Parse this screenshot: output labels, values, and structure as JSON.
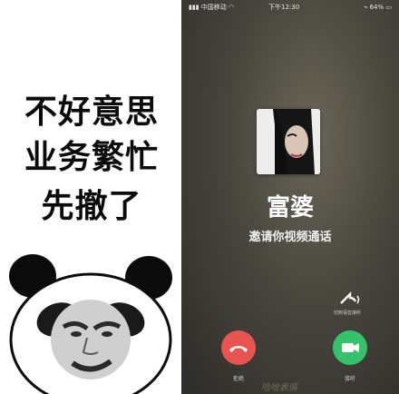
{
  "meme": {
    "caption_lines": [
      "不好意思",
      "业务繁忙",
      "先撤了"
    ]
  },
  "call": {
    "status_bar": {
      "carrier": "中国移动",
      "time": "下午12:30",
      "battery": "64%"
    },
    "caller_name": "富婆",
    "subtitle": "邀请你视频通话",
    "switch_label": "切到语音接听",
    "decline_label": "拒绝",
    "accept_label": "接听",
    "watermark": "哈哈表情"
  },
  "colors": {
    "decline": "#e85550",
    "accept": "#36c26a",
    "caption_text": "#0b0b0b"
  }
}
